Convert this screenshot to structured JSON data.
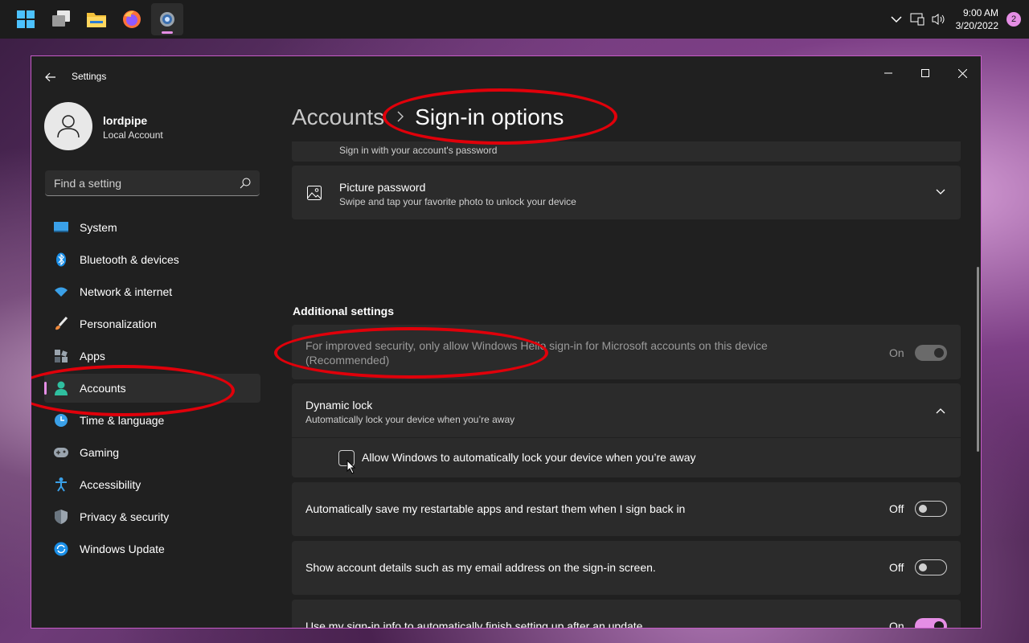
{
  "taskbar": {
    "apps": [
      {
        "name": "start-button"
      },
      {
        "name": "task-view"
      },
      {
        "name": "file-explorer"
      },
      {
        "name": "firefox"
      },
      {
        "name": "settings"
      }
    ],
    "time": "9:00 AM",
    "date": "3/20/2022",
    "notification_count": "2"
  },
  "window": {
    "title": "Settings"
  },
  "profile": {
    "name": "lordpipe",
    "account_type": "Local Account"
  },
  "search": {
    "placeholder": "Find a setting"
  },
  "sidebar": {
    "items": [
      {
        "label": "System",
        "icon": "system-icon"
      },
      {
        "label": "Bluetooth & devices",
        "icon": "bluetooth-icon"
      },
      {
        "label": "Network & internet",
        "icon": "wifi-icon"
      },
      {
        "label": "Personalization",
        "icon": "brush-icon"
      },
      {
        "label": "Apps",
        "icon": "apps-icon"
      },
      {
        "label": "Accounts",
        "icon": "accounts-icon",
        "selected": true
      },
      {
        "label": "Time & language",
        "icon": "clock-icon"
      },
      {
        "label": "Gaming",
        "icon": "gamepad-icon"
      },
      {
        "label": "Accessibility",
        "icon": "accessibility-icon"
      },
      {
        "label": "Privacy & security",
        "icon": "shield-icon"
      },
      {
        "label": "Windows Update",
        "icon": "update-icon"
      }
    ]
  },
  "breadcrumb": {
    "parent": "Accounts",
    "separator": ">",
    "current": "Sign-in options"
  },
  "main": {
    "password_card": {
      "subtitle": "Sign in with your account's password"
    },
    "picture_password": {
      "title": "Picture password",
      "subtitle": "Swipe and tap your favorite photo to unlock your device"
    },
    "additional_heading": "Additional settings",
    "hello_only": {
      "title_line1": "For improved security, only allow Windows Hello sign-in for Microsoft accounts on this device",
      "title_line2": "(Recommended)",
      "state": "On",
      "enabled": false
    },
    "dynamic_lock": {
      "title": "Dynamic lock",
      "subtitle": "Automatically lock your device when you’re away",
      "checkbox_label": "Allow Windows to automatically lock your device when you’re away",
      "checked": false
    },
    "restart_apps": {
      "title": "Automatically save my restartable apps and restart them when I sign back in",
      "state": "Off"
    },
    "account_details": {
      "title": "Show account details such as my email address on the sign-in screen.",
      "state": "Off"
    },
    "signin_info": {
      "title": "Use my sign-in info to automatically finish setting up after an update",
      "state": "On"
    }
  },
  "colors": {
    "accent": "#e58ee5",
    "annotation": "#e0000a",
    "window_bg": "#202020",
    "card_bg": "#2b2b2b"
  }
}
